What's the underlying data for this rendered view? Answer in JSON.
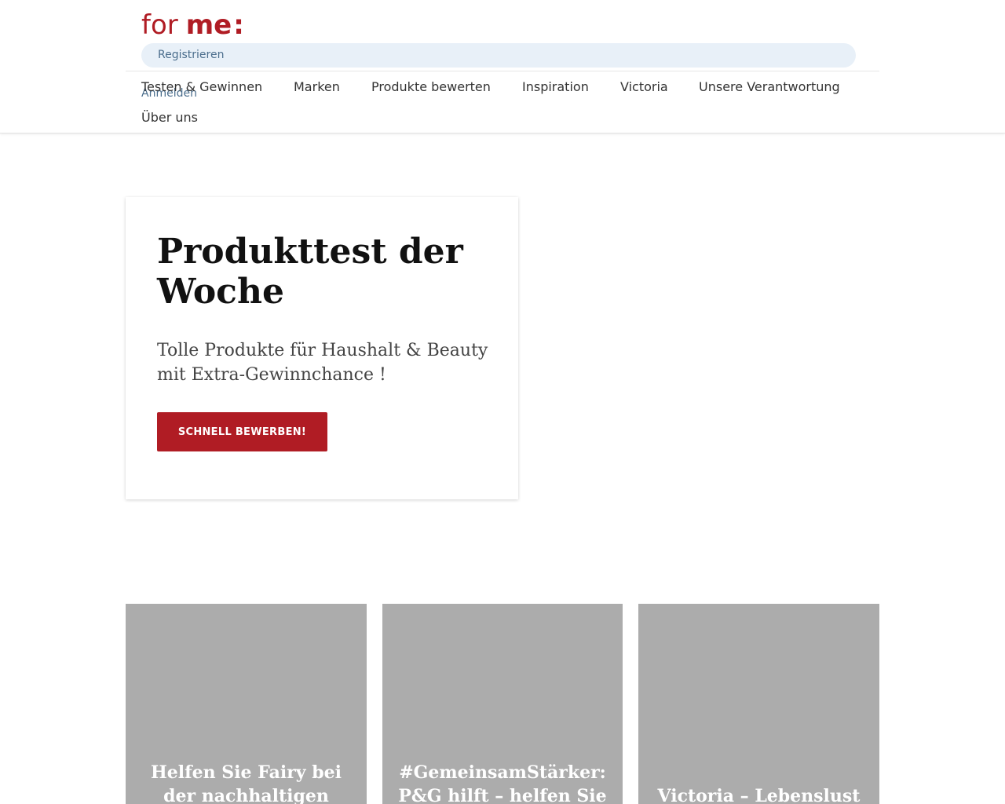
{
  "brand": {
    "logo_for": "for",
    "logo_me": "me",
    "logo_colon": ":",
    "accent_color": "#b01c24"
  },
  "account": {
    "register_label": "Registrieren",
    "login_label": "Anmelden"
  },
  "nav": {
    "items": [
      {
        "label": "Testen & Gewinnen"
      },
      {
        "label": "Marken"
      },
      {
        "label": "Produkte bewerten"
      },
      {
        "label": "Inspiration"
      },
      {
        "label": "Victoria"
      },
      {
        "label": "Unsere Verantwortung"
      },
      {
        "label": "Über uns"
      }
    ]
  },
  "hero": {
    "title": "Produkttest der Woche",
    "subtitle": "Tolle Produkte für Haushalt & Beauty mit Extra-Gewinnchance !",
    "cta_label": "SCHNELL BEWERBEN!"
  },
  "teasers": [
    {
      "title": "Helfen Sie Fairy bei der nachhaltigen"
    },
    {
      "title": "#GemeinsamStärker: P&G hilft – helfen Sie"
    },
    {
      "title": "Victoria – Lebenslust"
    }
  ]
}
